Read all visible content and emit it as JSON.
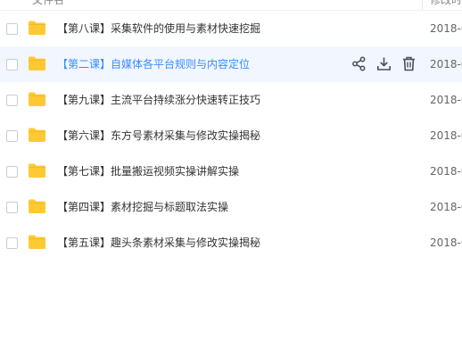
{
  "header": {
    "name_label": "文件名",
    "date_label": "修改时间"
  },
  "files": [
    {
      "name": "【第八课】采集软件的使用与素材快速挖掘",
      "date": "2018-0",
      "icon": "folder-icon"
    },
    {
      "name": "【第二课】自媒体各平台规则与内容定位",
      "date": "2018-0",
      "icon": "folder-icon",
      "hovered": true
    },
    {
      "name": "【第九课】主流平台持续涨分快速转正技巧",
      "date": "2018-0",
      "icon": "folder-icon"
    },
    {
      "name": "【第六课】东方号素材采集与修改实操揭秘",
      "date": "2018-0",
      "icon": "folder-icon"
    },
    {
      "name": "【第七课】批量搬运视频实操讲解实操",
      "date": "2018-0",
      "icon": "folder-icon"
    },
    {
      "name": "【第四课】素材挖掘与标题取法实操",
      "date": "2018-0",
      "icon": "folder-icon"
    },
    {
      "name": "【第五课】趣头条素材采集与修改实操揭秘",
      "date": "2018-0",
      "icon": "folder-icon"
    }
  ],
  "row_actions": [
    "share-icon",
    "download-icon",
    "delete-icon"
  ],
  "colors": {
    "folder": "#ffc933",
    "hover_bg": "#f1f6ff",
    "hover_text": "#3b8cff",
    "action_icon": "#4a4f58"
  }
}
